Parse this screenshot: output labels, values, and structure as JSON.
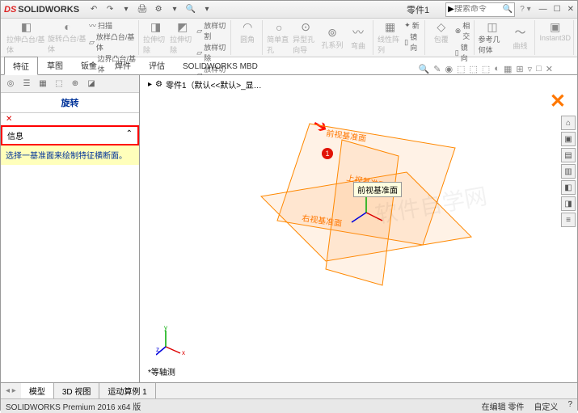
{
  "app": {
    "brand_icon": "DS",
    "brand": "SOLIDWORKS",
    "doc": "零件1",
    "search_ph": "搜索命令"
  },
  "qat": [
    "↶",
    "↷",
    "▾",
    "🖨",
    "⚙",
    "▾",
    "🔍",
    "▾"
  ],
  "ribbon": {
    "groups": [
      {
        "big": [
          {
            "label": "拉伸凸台/基体",
            "ico": "◧"
          },
          {
            "label": "旋转凸台/基体",
            "ico": "◐"
          }
        ],
        "list": [
          "扫描",
          "放样凸台/基体",
          "边界凸台/基体"
        ]
      },
      {
        "big": [
          {
            "label": "拉伸切除",
            "ico": "◨"
          },
          {
            "label": "拉伸切除",
            "ico": "◩"
          }
        ],
        "list": [
          "放样切割",
          "放样切除",
          "放样切除"
        ]
      },
      {
        "big": [
          {
            "label": "圆角",
            "ico": "◠"
          }
        ]
      },
      {
        "big": [
          {
            "label": "简单直孔",
            "ico": "○"
          },
          {
            "label": "异型孔向导",
            "ico": "⊙"
          },
          {
            "label": "孔系列",
            "ico": "⊚"
          },
          {
            "label": "弯曲",
            "ico": "〰"
          }
        ]
      },
      {
        "big": [
          {
            "label": "线性阵列",
            "ico": "▦"
          }
        ],
        "list": [
          "新",
          "镜向"
        ]
      },
      {
        "big": [
          {
            "label": "包覆",
            "ico": "◇"
          }
        ],
        "list": [
          "相交",
          "镜向"
        ]
      },
      {
        "big": [
          {
            "label": "参考几何体",
            "ico": "◫"
          },
          {
            "label": "曲线",
            "ico": "〜"
          }
        ]
      },
      {
        "big": [
          {
            "label": "Instant3D",
            "ico": "▣"
          }
        ]
      }
    ]
  },
  "tabs": [
    "特征",
    "草图",
    "钣金",
    "焊件",
    "评估",
    "SOLIDWORKS MBD"
  ],
  "tab_icons": [
    "🔍",
    "✎",
    "◉",
    "⬚",
    "⬚",
    "⬚",
    "◐",
    "▦",
    "⊞",
    "▿",
    "□",
    "✕"
  ],
  "panel": {
    "icons": [
      "◎",
      "☰",
      "▦",
      "⬚",
      "⊕",
      "◪"
    ],
    "title": "旋转",
    "info_hdr": "信息",
    "info_body": "选择一基准面来绘制特征横断面。"
  },
  "canvas": {
    "crumb": "零件1（默认<<默认>_显…",
    "planes": {
      "front": "前视基准面",
      "top": "上视基准面",
      "right": "右视基准面"
    },
    "tooltip": "前视基准面",
    "side": [
      "⌂",
      "▣",
      "▤",
      "▥",
      "◧",
      "◨",
      "≡"
    ],
    "triad": {
      "x": "x",
      "y": "y",
      "z": "z"
    },
    "view_lbl": "*等轴测",
    "marker": "1"
  },
  "btm_tabs": [
    "模型",
    "3D 视图",
    "运动算例 1"
  ],
  "status": {
    "left": "SOLIDWORKS Premium 2016 x64 版",
    "edit": "在编辑 零件",
    "custom": "自定义"
  }
}
